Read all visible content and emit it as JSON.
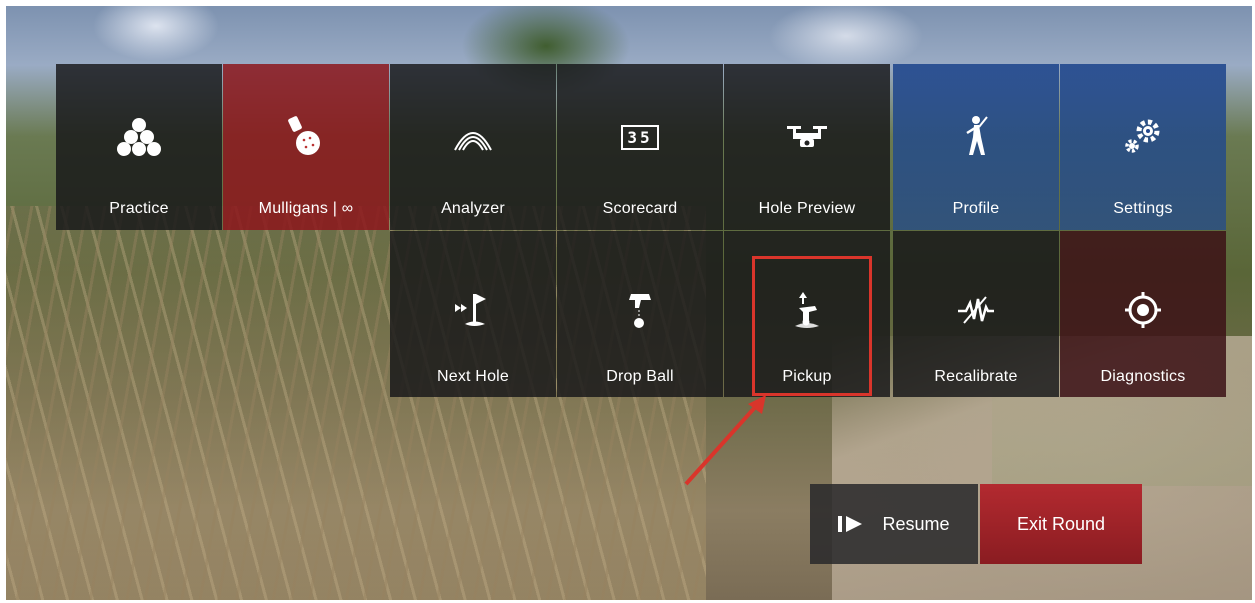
{
  "menu": {
    "row1": [
      {
        "label": "Practice",
        "icon": "golf-balls-icon"
      },
      {
        "label": "Mulligans | ∞",
        "icon": "mulligan-ball-icon"
      },
      {
        "label": "Analyzer",
        "icon": "shot-arc-icon"
      },
      {
        "label": "Scorecard",
        "icon": "scorecard-icon",
        "icon_text": "35"
      },
      {
        "label": "Hole Preview",
        "icon": "drone-icon"
      },
      {
        "label": "Profile",
        "icon": "golfer-icon"
      },
      {
        "label": "Settings",
        "icon": "gears-icon"
      }
    ],
    "row2": [
      {
        "label": "Next Hole",
        "icon": "next-hole-flag-icon"
      },
      {
        "label": "Drop Ball",
        "icon": "drop-ball-icon"
      },
      {
        "label": "Pickup",
        "icon": "pickup-hand-icon"
      },
      {
        "label": "Recalibrate",
        "icon": "waveform-icon"
      },
      {
        "label": "Diagnostics",
        "icon": "target-icon"
      }
    ]
  },
  "buttons": {
    "resume": "Resume",
    "exit": "Exit Round"
  },
  "colors": {
    "tile_dark": "#161618",
    "mulligans_red": "#8c161c",
    "profile_blue": "#1e468c",
    "diagnostics_darkred": "#3c1216",
    "highlight": "#d9352b",
    "exit_red": "#b32a30"
  }
}
